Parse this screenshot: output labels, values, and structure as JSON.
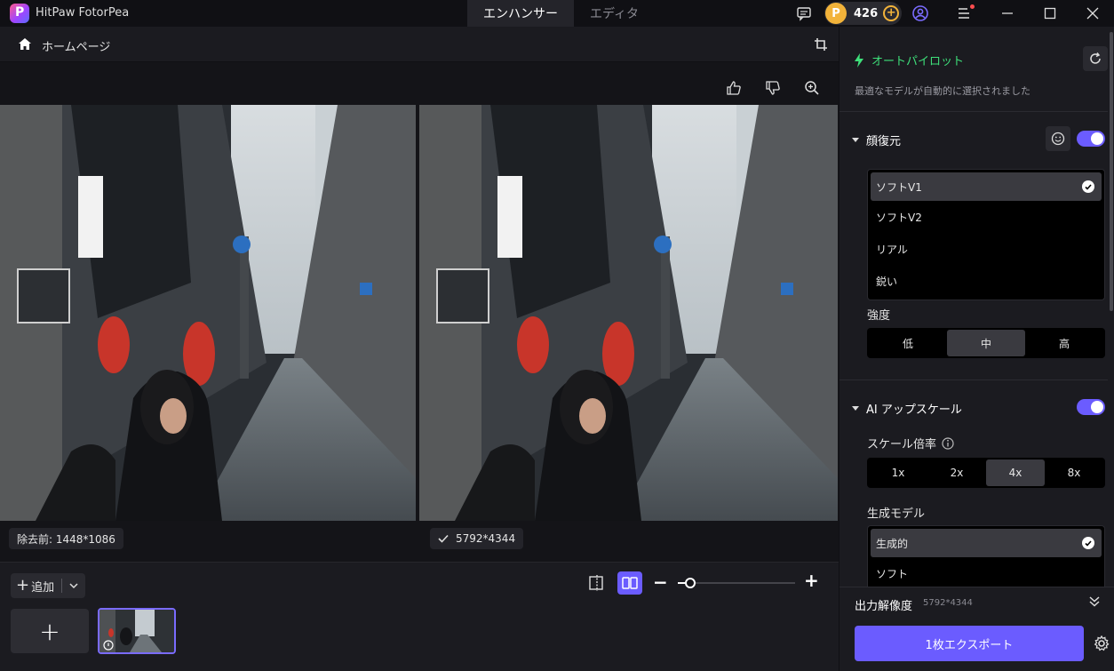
{
  "app": {
    "title": "HitPaw FotorPea"
  },
  "modes": [
    {
      "label": "エンハンサー",
      "active": true
    },
    {
      "label": "エディタ",
      "active": false
    }
  ],
  "credits": {
    "coin_symbol": "P",
    "count": "426"
  },
  "nav": {
    "home_label": "ホームページ"
  },
  "preview": {
    "before_label": "除去前: 1448*1086",
    "after_label": "5792*4344"
  },
  "bottom": {
    "add_label": "追加",
    "zoom_level": 0.07
  },
  "panel": {
    "autopilot": {
      "title": "オートパイロット",
      "subtitle": "最適なモデルが自動的に選択されました"
    },
    "face": {
      "title": "顔復元",
      "enabled": true,
      "models": [
        "ソフトV1",
        "ソフトV2",
        "リアル",
        "鋭い"
      ],
      "selected_model": "ソフトV1",
      "strength_label": "強度",
      "strength_options": [
        "低",
        "中",
        "高"
      ],
      "strength_selected": "中"
    },
    "upscale": {
      "title": "AI アップスケール",
      "enabled": true,
      "scale_label": "スケール倍率",
      "scale_options": [
        "1x",
        "2x",
        "4x",
        "8x"
      ],
      "scale_selected": "4x",
      "model_label": "生成モデル",
      "models": [
        "生成的",
        "ソフト"
      ],
      "selected_model": "生成的"
    },
    "output": {
      "label": "出力解像度",
      "value": "5792*4344"
    },
    "export_label": "1枚エクスポート"
  },
  "colors": {
    "accent": "#6b5cff",
    "autopilot_green": "#3ee07a",
    "coin": "#f2b33a"
  }
}
